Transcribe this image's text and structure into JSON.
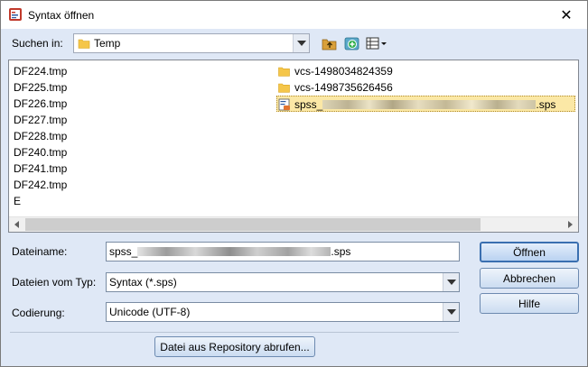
{
  "window": {
    "title": "Syntax öffnen",
    "close_glyph": "✕"
  },
  "lookin": {
    "label": "Suchen in:",
    "value": "Temp"
  },
  "files": {
    "left_column": [
      "DF224.tmp",
      "DF225.tmp",
      "DF226.tmp",
      "DF227.tmp",
      "DF228.tmp",
      "DF240.tmp",
      "DF241.tmp",
      "DF242.tmp",
      "E"
    ],
    "folders": [
      "vcs-1498034824359",
      "vcs-1498735626456"
    ],
    "selected_prefix": "spss_",
    "selected_suffix": ".sps"
  },
  "filename": {
    "label": "Dateiname:",
    "prefix": "spss_",
    "suffix": ".sps"
  },
  "filetype": {
    "label": "Dateien vom Typ:",
    "value": "Syntax (*.sps)"
  },
  "encoding": {
    "label": "Codierung:",
    "value": "Unicode (UTF-8)"
  },
  "buttons": {
    "open": "Öffnen",
    "cancel": "Abbrechen",
    "help": "Hilfe",
    "repository": "Datei aus Repository abrufen..."
  },
  "colors": {
    "dialog_bg": "#dfe8f6",
    "selection": "#fbe8a6",
    "folder": "#f5c64a"
  },
  "icons": [
    "syntax-app-icon",
    "close-icon",
    "folder-icon",
    "up-folder-icon",
    "new-folder-icon",
    "view-menu-icon",
    "sps-file-icon"
  ]
}
